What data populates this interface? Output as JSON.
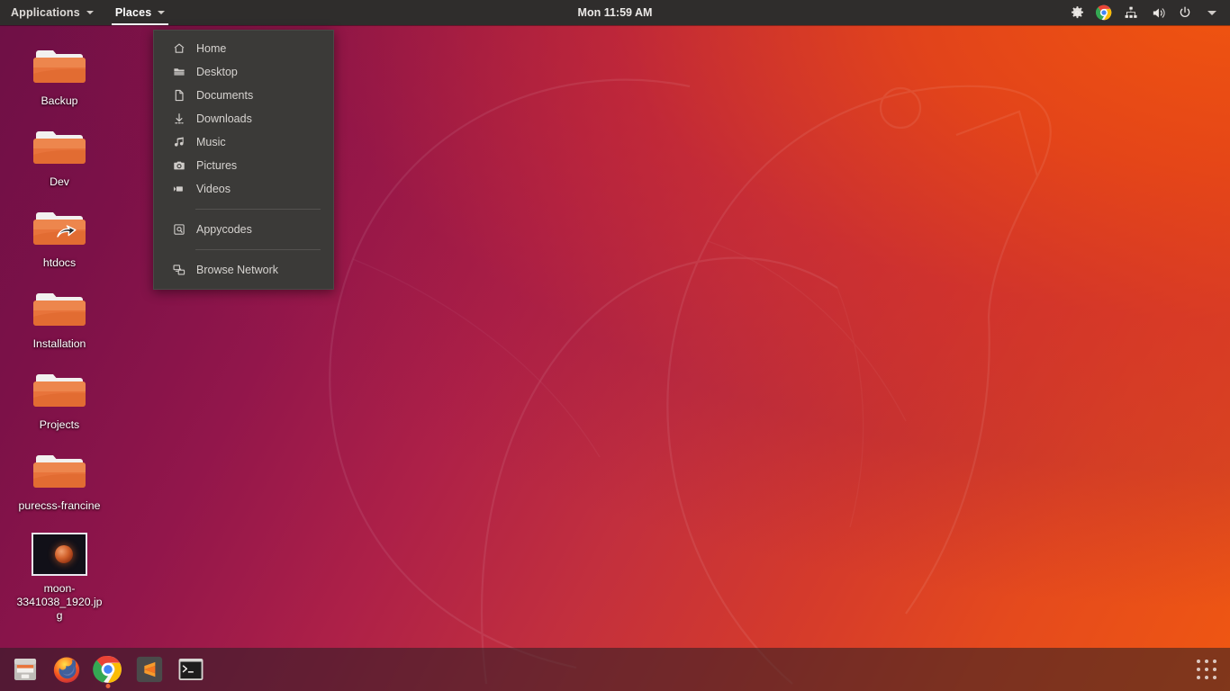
{
  "top_panel": {
    "applications_label": "Applications",
    "places_label": "Places",
    "clock": "Mon 11:59 AM",
    "tray": [
      {
        "name": "settings-gear-icon",
        "label": "Settings"
      },
      {
        "name": "chrome-indicator-icon",
        "label": "Google Chrome"
      },
      {
        "name": "network-icon",
        "label": "Network"
      },
      {
        "name": "volume-icon",
        "label": "Volume"
      },
      {
        "name": "power-icon",
        "label": "Power"
      },
      {
        "name": "chevron-down-icon",
        "label": "System menu"
      }
    ]
  },
  "places_menu": {
    "items": [
      {
        "label": "Home",
        "icon": "home-icon"
      },
      {
        "label": "Desktop",
        "icon": "folder-icon"
      },
      {
        "label": "Documents",
        "icon": "document-icon"
      },
      {
        "label": "Downloads",
        "icon": "download-icon"
      },
      {
        "label": "Music",
        "icon": "music-note-icon"
      },
      {
        "label": "Pictures",
        "icon": "camera-icon"
      },
      {
        "label": "Videos",
        "icon": "video-camera-icon"
      }
    ],
    "volume_label": "Appycodes",
    "volume_icon": "drive-icon",
    "network_label": "Browse Network",
    "network_icon": "network-share-icon"
  },
  "desktop_icons": [
    {
      "label": "Backup",
      "type": "folder",
      "symlink": false
    },
    {
      "label": "Dev",
      "type": "folder",
      "symlink": false
    },
    {
      "label": "htdocs",
      "type": "folder",
      "symlink": true
    },
    {
      "label": "Installation",
      "type": "folder",
      "symlink": false
    },
    {
      "label": "Projects",
      "type": "folder",
      "symlink": false
    },
    {
      "label": "purecss-francine",
      "type": "folder",
      "symlink": false
    },
    {
      "label": "moon-3341038_1920.jpg",
      "type": "image",
      "symlink": false
    }
  ],
  "dock": {
    "apps": [
      {
        "name": "files-nautilus",
        "label": "Files",
        "running": false
      },
      {
        "name": "firefox",
        "label": "Firefox",
        "running": false
      },
      {
        "name": "google-chrome",
        "label": "Google Chrome",
        "running": true
      },
      {
        "name": "sublime-text",
        "label": "Sublime Text",
        "running": false
      },
      {
        "name": "terminal",
        "label": "Terminal",
        "running": false
      }
    ],
    "show_applications_label": "Show Applications"
  },
  "colors": {
    "panel_bg": "#2f2d2c",
    "menu_bg": "#3b3a38",
    "wallpaper_warm": "#ef5712",
    "wallpaper_cool": "#6e1046",
    "accent_orange": "#e8623a"
  }
}
